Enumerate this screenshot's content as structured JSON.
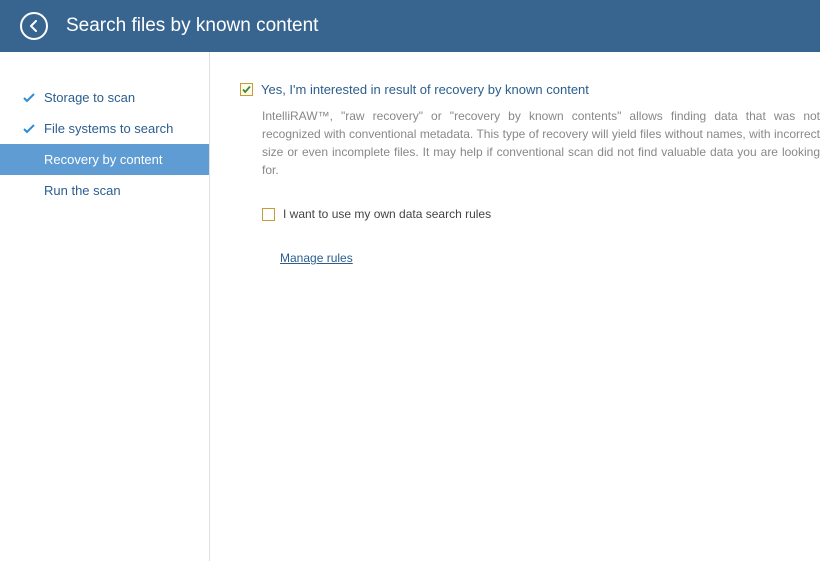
{
  "header": {
    "title": "Search files by known content"
  },
  "sidebar": {
    "items": [
      {
        "label": "Storage to scan",
        "checked": true,
        "active": false
      },
      {
        "label": "File systems to search",
        "checked": true,
        "active": false
      },
      {
        "label": "Recovery by content",
        "checked": false,
        "active": true
      },
      {
        "label": "Run the scan",
        "checked": false,
        "active": false
      }
    ]
  },
  "main": {
    "primary_checkbox_label": "Yes, I'm interested in result of recovery by known content",
    "primary_checked": true,
    "description": "IntelliRAW™, \"raw recovery\" or \"recovery by known contents\" allows finding data that was not recognized with conventional metadata. This type of recovery will yield files without names, with incorrect size or even incomplete files. It may help if conventional scan did not find valuable data you are looking for.",
    "own_rules_label": "I want to use my own data search rules",
    "own_rules_checked": false,
    "manage_rules_label": "Manage rules"
  }
}
